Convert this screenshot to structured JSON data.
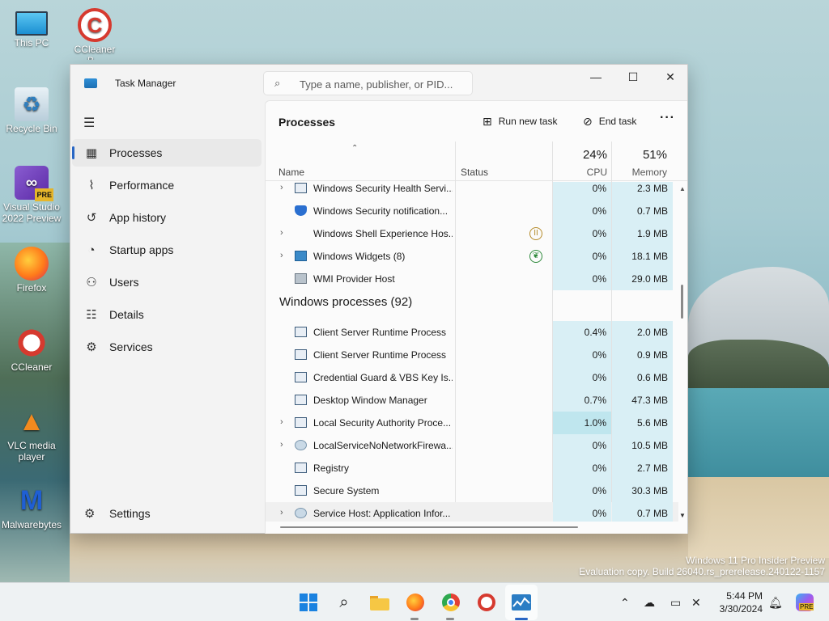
{
  "desktop": {
    "icons": [
      {
        "label": "This PC"
      },
      {
        "label": "CCleaner",
        "sub": "B..."
      },
      {
        "label": "Recycle Bin"
      },
      {
        "label": "Visual Studio 2022 Preview",
        "badge": "PRE"
      },
      {
        "label": "Firefox"
      },
      {
        "label": "CCleaner"
      },
      {
        "label": "VLC media player"
      },
      {
        "label": "Malwarebytes"
      }
    ],
    "watermark": {
      "line1": "Windows 11 Pro Insider Preview",
      "line2": "Evaluation copy. Build 26040.rs_prerelease.240122-1157"
    }
  },
  "window": {
    "title": "Task Manager",
    "search_placeholder": "Type a name, publisher, or PID...",
    "controls": {
      "minimize": "—",
      "maximize": "☐",
      "close": "✕"
    }
  },
  "sidebar": {
    "items": [
      {
        "label": "Processes",
        "icon": "processes-icon",
        "active": true
      },
      {
        "label": "Performance",
        "icon": "performance-icon"
      },
      {
        "label": "App history",
        "icon": "history-icon"
      },
      {
        "label": "Startup apps",
        "icon": "startup-icon"
      },
      {
        "label": "Users",
        "icon": "users-icon"
      },
      {
        "label": "Details",
        "icon": "details-icon"
      },
      {
        "label": "Services",
        "icon": "services-icon"
      }
    ],
    "settings_label": "Settings"
  },
  "main": {
    "page_title": "Processes",
    "run_new_task": "Run new task",
    "end_task": "End task",
    "more": "···",
    "columns": {
      "name": "Name",
      "status": "Status",
      "cpu_pct": "24%",
      "cpu_label": "CPU",
      "mem_pct": "51%",
      "mem_label": "Memory"
    },
    "rows": [
      {
        "name": "Windows Security Health Servi...",
        "expand": true,
        "icon": "app",
        "status": "",
        "cpu": "0%",
        "mem": "2.3 MB"
      },
      {
        "name": "Windows Security notification...",
        "expand": false,
        "icon": "shield",
        "status": "",
        "cpu": "0%",
        "mem": "0.7 MB"
      },
      {
        "name": "Windows Shell Experience Hos...",
        "expand": true,
        "icon": "blank",
        "status": "paused",
        "cpu": "0%",
        "mem": "1.9 MB"
      },
      {
        "name": "Windows Widgets (8)",
        "expand": true,
        "icon": "widget",
        "status": "eco",
        "cpu": "0%",
        "mem": "18.1 MB"
      },
      {
        "name": "WMI Provider Host",
        "expand": false,
        "icon": "wmi",
        "status": "",
        "cpu": "0%",
        "mem": "29.0 MB"
      },
      {
        "group": "Windows processes (92)"
      },
      {
        "name": "Client Server Runtime Process",
        "expand": false,
        "icon": "app",
        "status": "",
        "cpu": "0.4%",
        "mem": "2.0 MB"
      },
      {
        "name": "Client Server Runtime Process",
        "expand": false,
        "icon": "app",
        "status": "",
        "cpu": "0%",
        "mem": "0.9 MB"
      },
      {
        "name": "Credential Guard & VBS Key Is...",
        "expand": false,
        "icon": "app",
        "status": "",
        "cpu": "0%",
        "mem": "0.6 MB"
      },
      {
        "name": "Desktop Window Manager",
        "expand": false,
        "icon": "app",
        "status": "",
        "cpu": "0.7%",
        "mem": "47.3 MB"
      },
      {
        "name": "Local Security Authority Proce...",
        "expand": true,
        "icon": "app",
        "status": "",
        "cpu": "1.0%",
        "mem": "5.6 MB",
        "hot": true
      },
      {
        "name": "LocalServiceNoNetworkFirewa...",
        "expand": true,
        "icon": "gear",
        "status": "",
        "cpu": "0%",
        "mem": "10.5 MB"
      },
      {
        "name": "Registry",
        "expand": false,
        "icon": "app",
        "status": "",
        "cpu": "0%",
        "mem": "2.7 MB"
      },
      {
        "name": "Secure System",
        "expand": false,
        "icon": "app",
        "status": "",
        "cpu": "0%",
        "mem": "30.3 MB"
      },
      {
        "name": "Service Host: Application Infor...",
        "expand": true,
        "icon": "gear",
        "status": "",
        "cpu": "0%",
        "mem": "0.7 MB",
        "hover": true
      }
    ]
  },
  "taskbar": {
    "apps": [
      "start-icon",
      "search-icon",
      "file-explorer-icon",
      "firefox-icon",
      "chrome-icon",
      "ccleaner-icon",
      "task-manager-icon"
    ],
    "clock_time": "5:44 PM",
    "clock_date": "3/30/2024",
    "copilot_badge": "PRE"
  }
}
